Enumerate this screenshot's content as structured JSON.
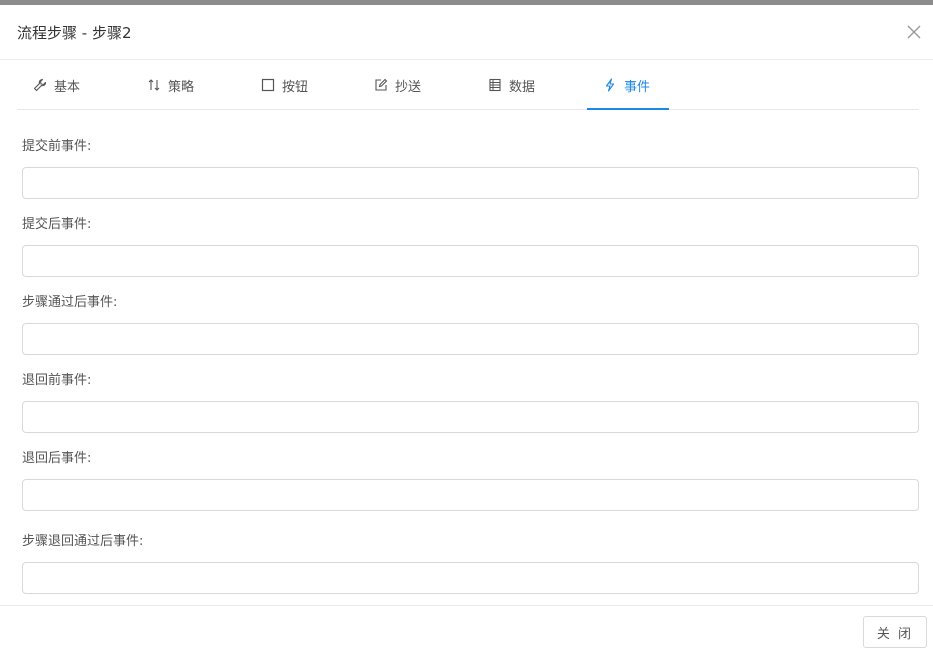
{
  "dialog": {
    "title": "流程步骤 - 步骤2"
  },
  "tabs": [
    {
      "label": "基本",
      "icon": "wrench-icon"
    },
    {
      "label": "策略",
      "icon": "swap-icon"
    },
    {
      "label": "按钮",
      "icon": "square-icon"
    },
    {
      "label": "抄送",
      "icon": "edit-icon"
    },
    {
      "label": "数据",
      "icon": "table-icon"
    },
    {
      "label": "事件",
      "icon": "lightning-icon",
      "active": true
    }
  ],
  "fields": [
    {
      "label": "提交前事件:",
      "value": ""
    },
    {
      "label": "提交后事件:",
      "value": ""
    },
    {
      "label": "步骤通过后事件:",
      "value": ""
    },
    {
      "label": "退回前事件:",
      "value": ""
    },
    {
      "label": "退回后事件:",
      "value": ""
    },
    {
      "label": "步骤退回通过后事件:",
      "value": ""
    }
  ],
  "footer": {
    "close_label": "关 闭"
  },
  "colors": {
    "accent": "#1e88e5",
    "top_strip": "#8c8c8c"
  }
}
